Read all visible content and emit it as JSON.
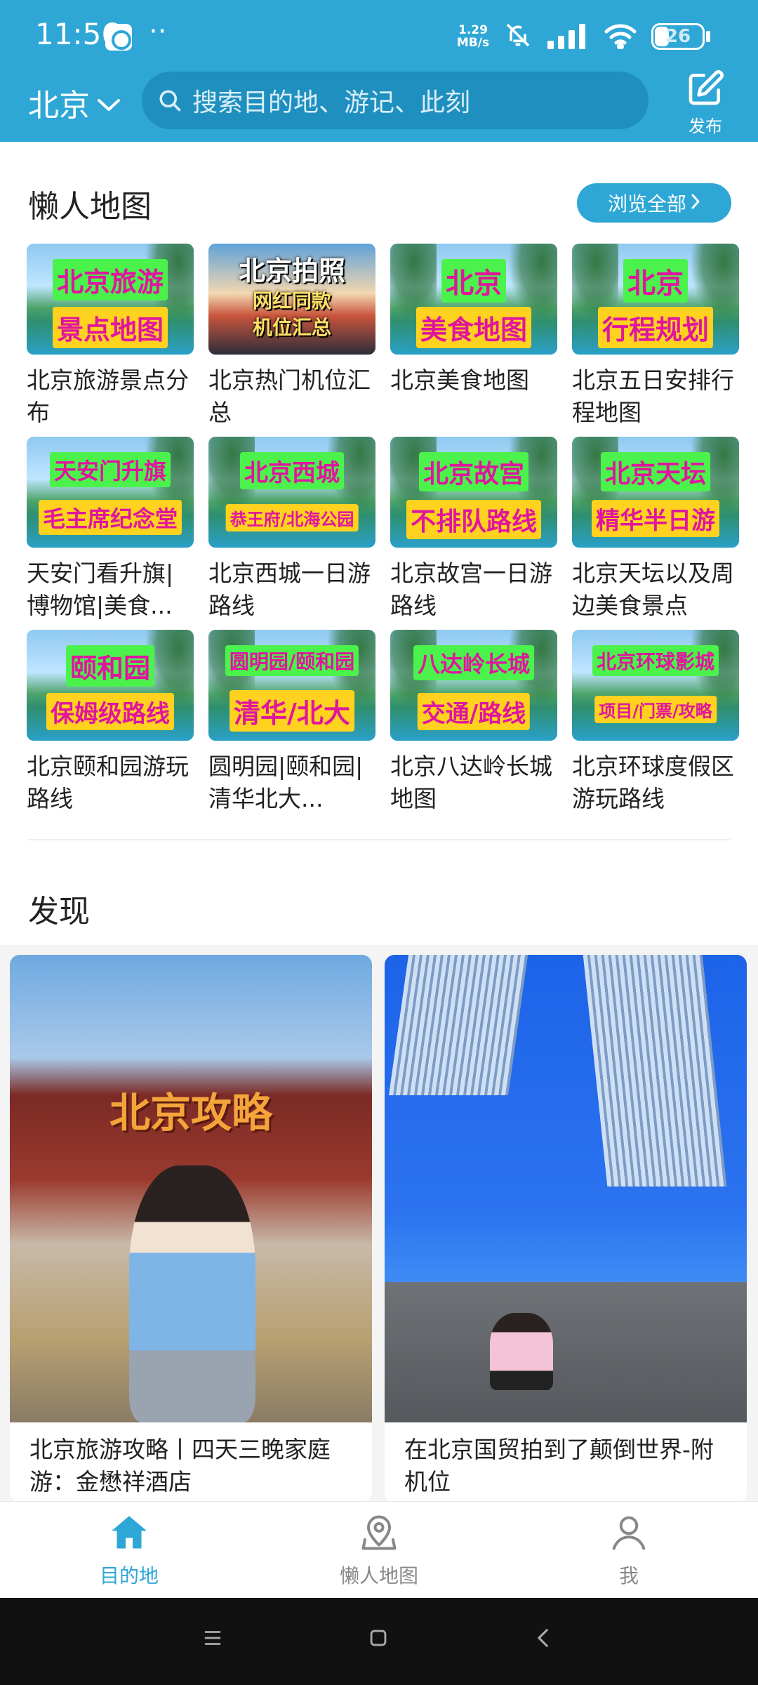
{
  "status_bar": {
    "time": "11:56",
    "extra": "··",
    "net_speed_value": "1.29",
    "net_speed_unit": "MB/s",
    "battery": "26"
  },
  "header": {
    "city": "北京",
    "search_placeholder": "搜索目的地、游记、此刻",
    "publish_label": "发布"
  },
  "lazy_map": {
    "title": "懒人地图",
    "browse_all": "浏览全部",
    "items": [
      {
        "thumb": [
          "北京旅游",
          "景点地图"
        ],
        "title": "北京旅游景点分布"
      },
      {
        "thumb": [
          "北京拍照",
          "网红同款",
          "机位汇总"
        ],
        "title": "北京热门机位汇总"
      },
      {
        "thumb": [
          "北京",
          "美食地图"
        ],
        "title": "北京美食地图"
      },
      {
        "thumb": [
          "北京",
          "行程规划"
        ],
        "title": "北京五日安排行程地图"
      },
      {
        "thumb": [
          "天安门升旗",
          "毛主席纪念堂"
        ],
        "title": "天安门看升旗|博物馆|美食..."
      },
      {
        "thumb": [
          "北京西城",
          "恭王府/北海公园"
        ],
        "title": "北京西城一日游路线"
      },
      {
        "thumb": [
          "北京故宫",
          "不排队路线"
        ],
        "title": "北京故宫一日游路线"
      },
      {
        "thumb": [
          "北京天坛",
          "精华半日游"
        ],
        "title": "北京天坛以及周边美食景点"
      },
      {
        "thumb": [
          "颐和园",
          "保姆级路线"
        ],
        "title": "北京颐和园游玩路线"
      },
      {
        "thumb": [
          "圆明园/颐和园",
          "清华/北大"
        ],
        "title": "圆明园|颐和园|清华北大..."
      },
      {
        "thumb": [
          "八达岭长城",
          "交通/路线"
        ],
        "title": "北京八达岭长城地图"
      },
      {
        "thumb": [
          "北京环球影城",
          "项目/门票/攻略"
        ],
        "title": "北京环球度假区游玩路线"
      }
    ]
  },
  "discover": {
    "title": "发现",
    "cards": [
      {
        "overlay": "北京攻略",
        "title": "北京旅游攻略丨四天三晚家庭游：金懋祥酒店"
      },
      {
        "overlay": "",
        "title": "在北京国贸拍到了颠倒世界-附机位"
      }
    ]
  },
  "bottom_nav": {
    "items": [
      {
        "label": "目的地",
        "active": true
      },
      {
        "label": "懒人地图",
        "active": false
      },
      {
        "label": "我",
        "active": false
      }
    ]
  },
  "colors": {
    "accent": "#2ea7d6",
    "tag_green": "#4cf24c",
    "tag_yellow": "#ffd21f",
    "tag_text": "#e0159f"
  }
}
